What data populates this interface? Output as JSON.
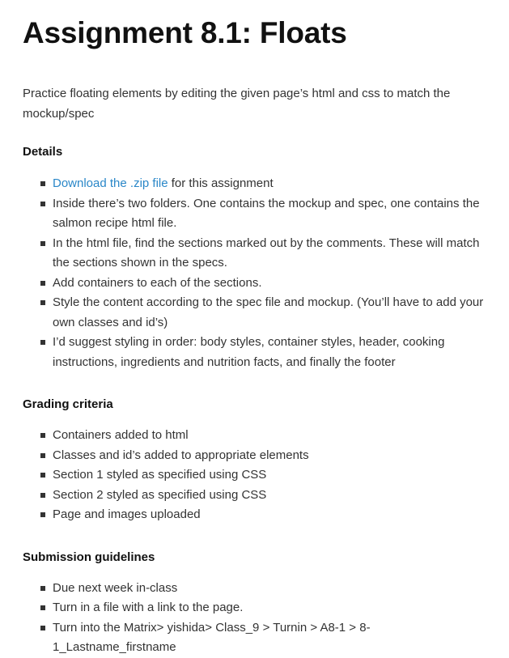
{
  "title": "Assignment 8.1: Floats",
  "intro": "Practice floating elements by editing the given page’s html and css to match the mockup/spec",
  "details": {
    "heading": "Details",
    "link_text": "Download the .zip file",
    "link_suffix": " for this assignment",
    "items": [
      "Inside there’s two folders. One contains the mockup and spec, one contains the salmon recipe html file.",
      "In the html file, find the sections marked out by the comments. These will match the sections shown in the specs.",
      "Add containers to each of the sections.",
      "Style the content according to the spec file and mockup. (You’ll have to add your own classes and id’s)",
      "I’d suggest styling in order: body styles, container styles, header, cooking instructions, ingredients and nutrition facts, and finally the footer"
    ]
  },
  "grading": {
    "heading": "Grading criteria",
    "items": [
      "Containers added to html",
      "Classes and id’s added to appropriate elements",
      "Section 1 styled as specified using CSS",
      "Section 2 styled as specified using CSS",
      "Page and images uploaded"
    ]
  },
  "submission": {
    "heading": "Submission guidelines",
    "items": [
      "Due next week in-class",
      "Turn in a file with a link to the page.",
      "Turn into the Matrix> yishida> Class_9 > Turnin > A8-1 > 8-1_Lastname_firstname"
    ]
  },
  "colors": {
    "link": "#2a87c8",
    "text": "#333333",
    "heading": "#111111"
  }
}
